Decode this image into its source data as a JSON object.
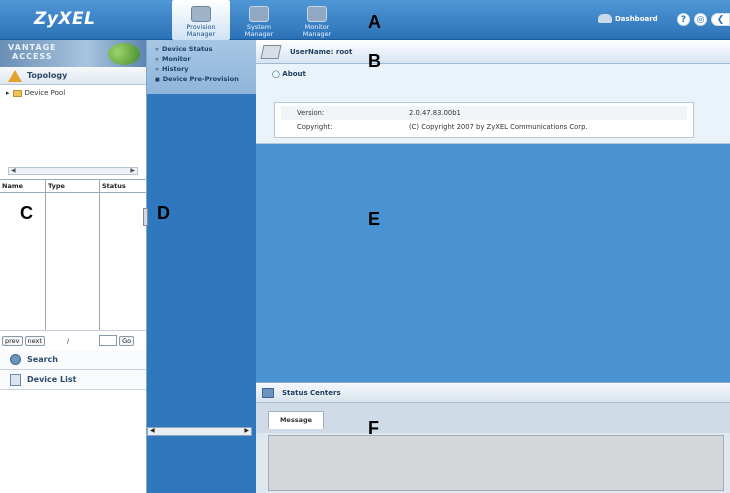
{
  "header": {
    "logo": "ZyXEL",
    "nav": [
      {
        "label": "Provision\nManager",
        "icon": "provision-manager-icon",
        "active": true
      },
      {
        "label": "System\nManager",
        "icon": "system-manager-icon",
        "active": false
      },
      {
        "label": "Monitor\nManager",
        "icon": "monitor-manager-icon",
        "active": false
      }
    ],
    "dashboard_label": "Dashboard"
  },
  "markers": {
    "a": "A",
    "b": "B",
    "c": "C",
    "d": "D",
    "e": "E",
    "f": "F"
  },
  "left_panel": {
    "brand": "VANTAGE\nACCESS",
    "topology_label": "Topology",
    "tree_root": "Device Pool",
    "columns": [
      "Name",
      "Type",
      "Status"
    ],
    "pager": {
      "prev": "prev",
      "next": "next",
      "separator": "/",
      "go": "Go"
    },
    "search_label": "Search",
    "device_list_label": "Device List"
  },
  "menu": {
    "items": [
      "Device Status",
      "Monitor",
      "History",
      "Device Pre-Provision"
    ]
  },
  "main": {
    "username_label": "UserName: root",
    "about_title": "About",
    "about_rows": [
      {
        "key": "Version:",
        "value": "2.0.47.83.00b1"
      },
      {
        "key": "Copyright:",
        "value": "(C) Copyright 2007 by ZyXEL Communications Corp."
      }
    ]
  },
  "status_center": {
    "title": "Status Centers",
    "tab": "Message"
  },
  "colors": {
    "accent": "#2c72b8",
    "content_bg": "#4a93d2"
  }
}
